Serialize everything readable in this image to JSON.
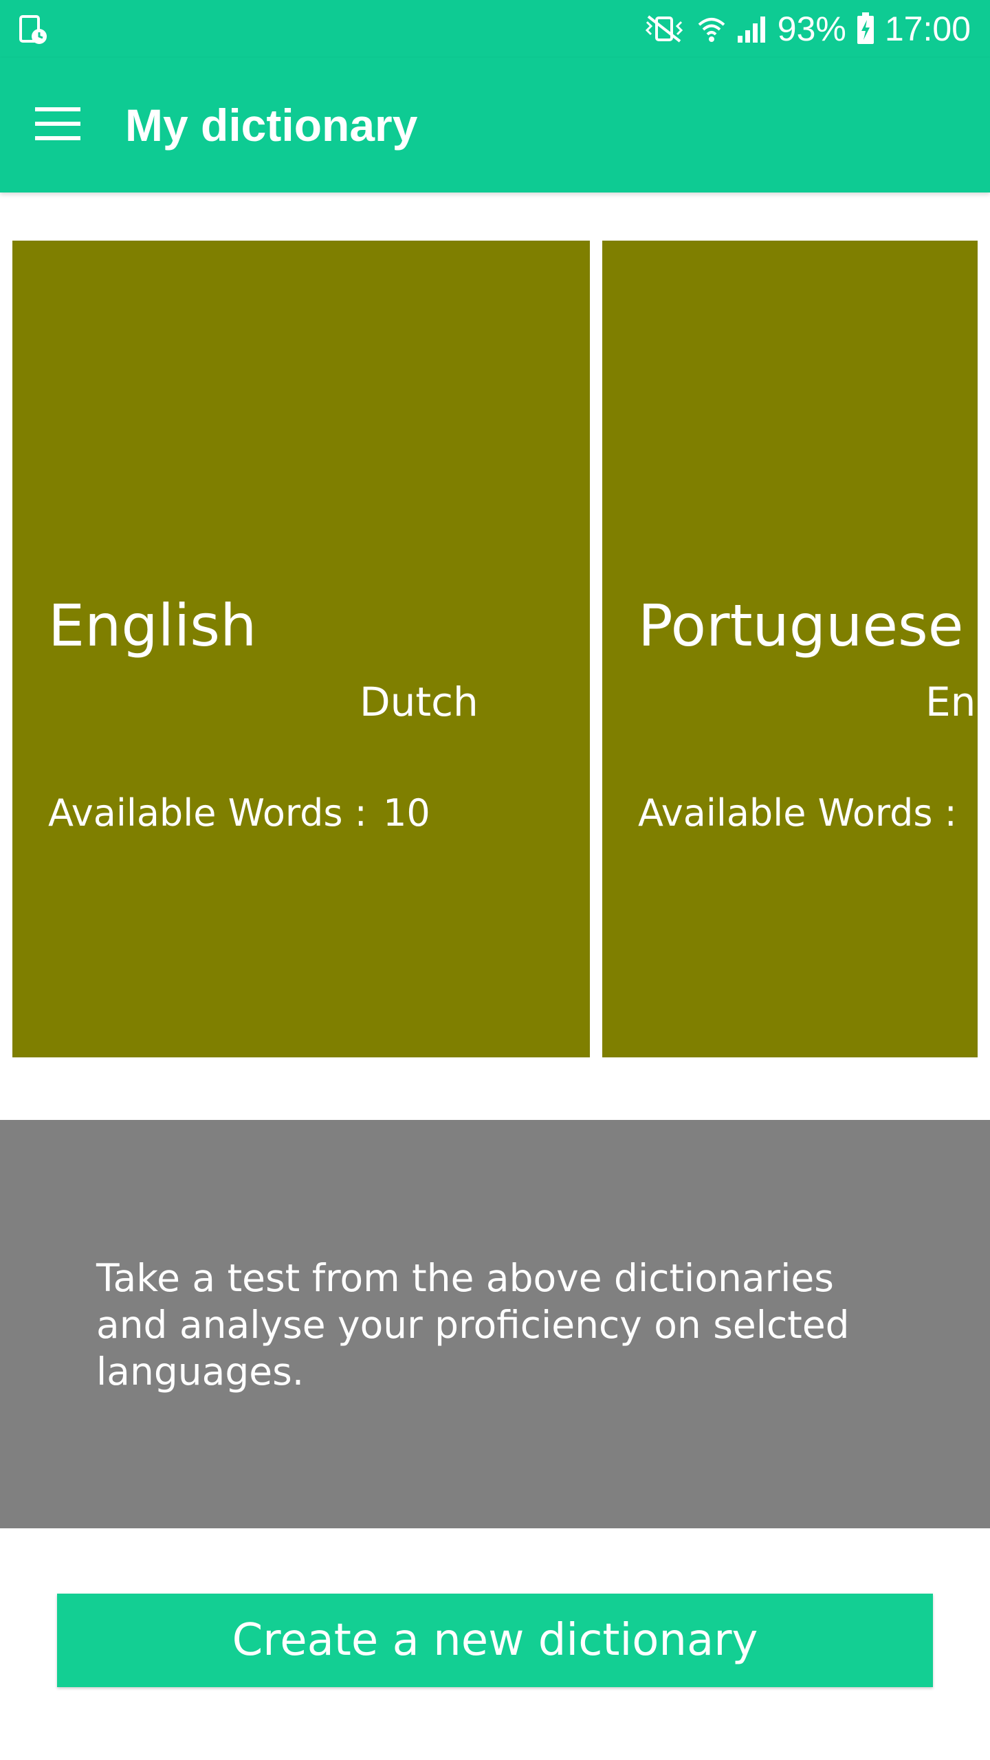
{
  "status_bar": {
    "left_icon": "screenshot-clock-icon",
    "icons": [
      "vibrate-mute-icon",
      "wifi-icon",
      "signal-icon"
    ],
    "battery_percent": "93%",
    "battery_icon": "battery-charging-icon",
    "time": "17:00"
  },
  "app_bar": {
    "menu_icon": "hamburger-menu-icon",
    "title": "My dictionary"
  },
  "dictionaries": [
    {
      "source_language": "English",
      "target_language": "Dutch",
      "words_label": "Available Words :",
      "words_count": "10"
    },
    {
      "source_language": "Portuguese",
      "target_language": "En",
      "words_label": "Available Words :",
      "words_count": ""
    }
  ],
  "info_panel": {
    "text": "Take a test from the above dictionaries and analyse your proficiency on selcted languages."
  },
  "create_button": {
    "label": "Create a new dictionary"
  },
  "colors": {
    "primary": "#0ecb93",
    "card": "#7f7f00",
    "info_panel": "#808080",
    "button": "#13cf93"
  }
}
